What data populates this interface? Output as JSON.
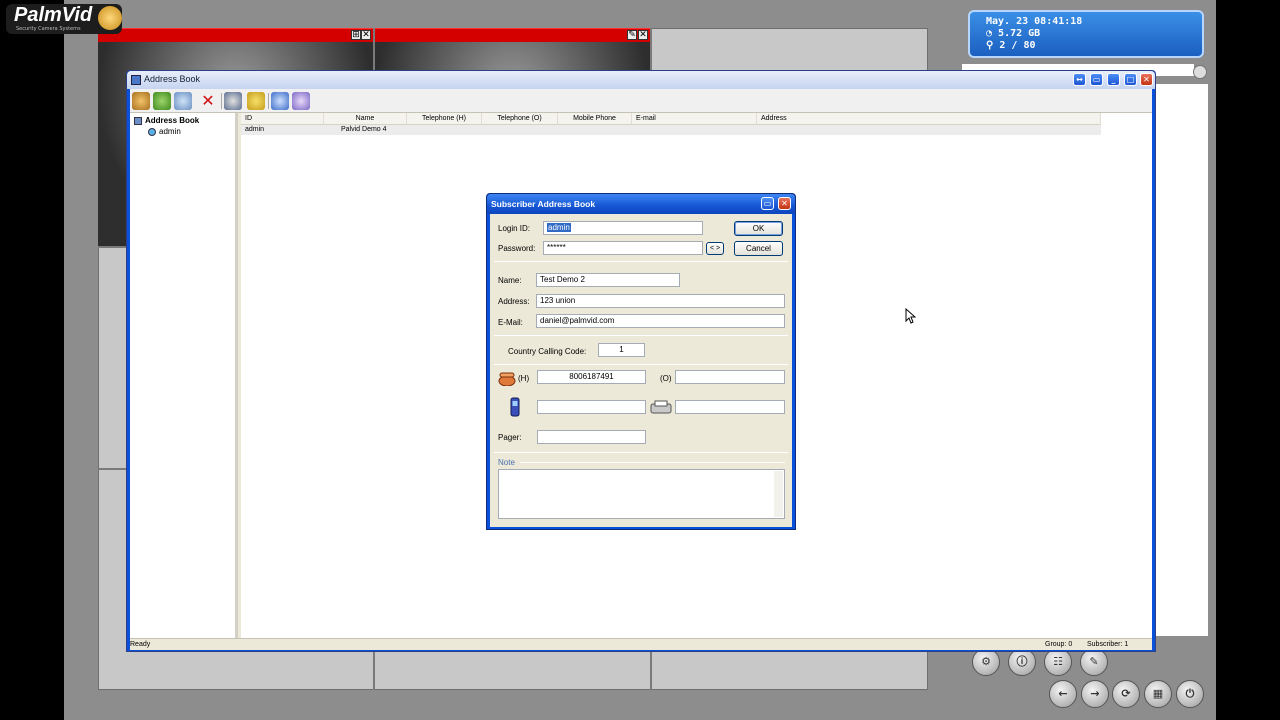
{
  "app": {
    "logo_text": "PalmVid",
    "logo_tagline": "Security Camera Systems",
    "status": {
      "datetime": "May. 23 08:41:18",
      "disk": "5.72 GB",
      "cameras": "2 / 80"
    },
    "camera_tiles": [
      {
        "buttons": [
          "✕"
        ]
      },
      {
        "buttons": [
          "✕"
        ]
      }
    ],
    "bottom_buttons": [
      "settings",
      "info",
      "address-book",
      "tools",
      "back",
      "forward",
      "refresh",
      "grid",
      "power"
    ]
  },
  "address_book": {
    "title": "Address Book",
    "tree": {
      "root": "Address Book",
      "children": [
        "admin"
      ]
    },
    "columns": [
      "ID",
      "Name",
      "Telephone (H)",
      "Telephone (O)",
      "Mobile Phone",
      "E-mail",
      "Address"
    ],
    "rows": [
      {
        "id": "admin",
        "name": "Palvid Demo 4",
        "tel_h": "",
        "tel_o": "",
        "mobile": "",
        "email": "",
        "address": ""
      }
    ],
    "statusbar": {
      "left": "Ready",
      "group": "Group: 0",
      "subscriber": "Subscriber: 1"
    }
  },
  "dialog": {
    "title": "Subscriber Address Book",
    "login_label": "Login ID:",
    "login_value": "admin",
    "password_label": "Password:",
    "password_value": "******",
    "reveal_label": "< >",
    "ok_label": "OK",
    "cancel_label": "Cancel",
    "name_label": "Name:",
    "name_value": "Test Demo 2",
    "address_label": "Address:",
    "address_value": "123 union",
    "email_label": "E-Mail:",
    "email_value": "daniel@palmvid.com",
    "country_label": "Country Calling Code:",
    "country_value": "1",
    "home_label": "(H)",
    "home_value": "8006187491",
    "office_label": "(O)",
    "office_value": "",
    "mobile_value": "",
    "fax_value": "",
    "pager_label": "Pager:",
    "pager_value": "",
    "note_label": "Note",
    "note_value": ""
  }
}
